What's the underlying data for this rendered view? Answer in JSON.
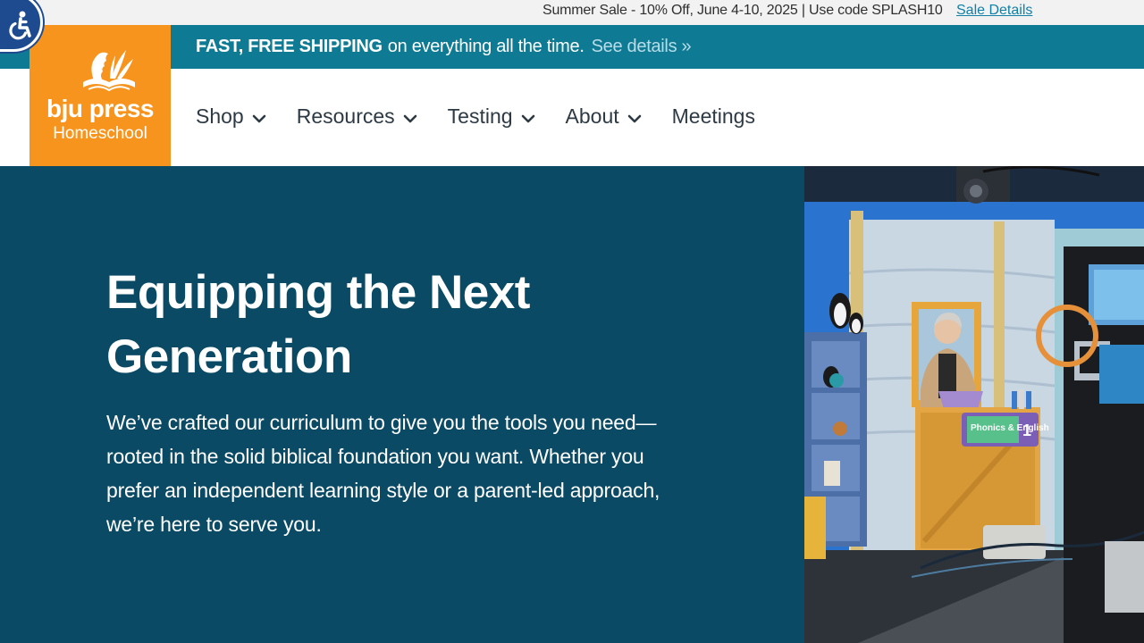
{
  "sale_bar": {
    "text": "Summer Sale - 10% Off, June 4-10, 2025 | Use code SPLASH10",
    "link": "Sale Details"
  },
  "shipping_bar": {
    "bold": "FAST, FREE SHIPPING",
    "text": "on everything all the time.",
    "link": "See details »"
  },
  "logo": {
    "word": "bju press",
    "sub": "Homeschool"
  },
  "nav": {
    "items": [
      {
        "label": "Shop"
      },
      {
        "label": "Resources"
      },
      {
        "label": "Testing"
      },
      {
        "label": "About"
      },
      {
        "label": "Meetings"
      }
    ]
  },
  "hero": {
    "title": "Equipping the Next Generation",
    "body": "We’ve crafted our curriculum to give you the tools you need—rooted in the solid biblical foundation you want. Whether you prefer an independent learning style or a parent-led approach, we’re here to serve you."
  },
  "photo": {
    "sign": "Phonics & English",
    "sign_number": "1"
  },
  "colors": {
    "brand_orange": "#f7941d",
    "ship_teal": "#0e7a93",
    "hero_navy": "#0a4a64",
    "link_blue": "#117fa6",
    "a11y_blue": "#1e4b8f"
  },
  "icons": {
    "accessibility": "wheelchair-icon",
    "dropdown": "chevron-down-icon"
  }
}
